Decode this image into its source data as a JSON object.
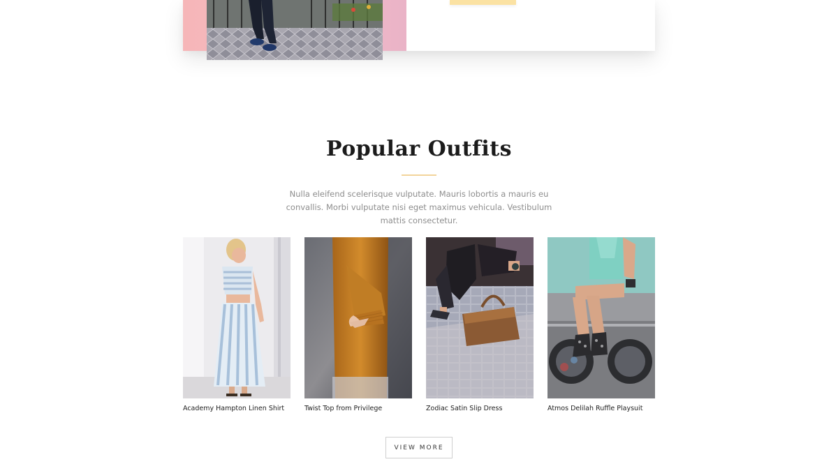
{
  "hero": {
    "cta_label": ""
  },
  "popular": {
    "title": "Popular Outfits",
    "description": "Nulla eleifend scelerisque vulputate. Mauris lobortis a mauris eu convallis. Morbi vulputate nisi eget maximus vehicula. Vestibulum mattis consectetur.",
    "products": [
      {
        "name": "Academy Hampton Linen Shirt"
      },
      {
        "name": "Twist Top from Privilege"
      },
      {
        "name": "Zodiac Satin Slip Dress"
      },
      {
        "name": "Atmos Delilah Ruffle Playsuit"
      }
    ],
    "view_more_label": "VIEW MORE"
  },
  "colors": {
    "accent": "#f3d49b",
    "hero_pink": "#f2bcc8",
    "title": "#1b1b1b",
    "body_text": "#8d8d8d"
  }
}
